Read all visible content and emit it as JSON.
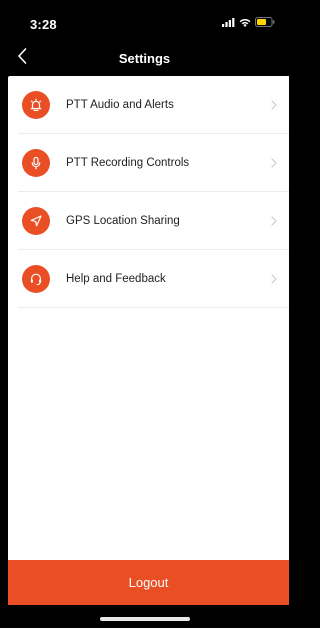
{
  "status_bar": {
    "time": "3:28",
    "icons": [
      "signal-icon",
      "wifi-icon",
      "battery-icon"
    ],
    "battery_color": "#ffd400"
  },
  "nav": {
    "title": "Settings",
    "back_icon": "chevron-left-icon"
  },
  "menu": {
    "items": [
      {
        "label": "PTT Audio and Alerts",
        "icon": "alarm-icon"
      },
      {
        "label": "PTT Recording Controls",
        "icon": "microphone-icon"
      },
      {
        "label": "GPS Location Sharing",
        "icon": "location-arrow-icon"
      },
      {
        "label": "Help and Feedback",
        "icon": "headset-icon"
      }
    ],
    "chevron_icon": "chevron-right-icon"
  },
  "logout": {
    "label": "Logout"
  },
  "colors": {
    "accent": "#ea4e25",
    "background": "#ffffff",
    "chrome": "#000000"
  }
}
